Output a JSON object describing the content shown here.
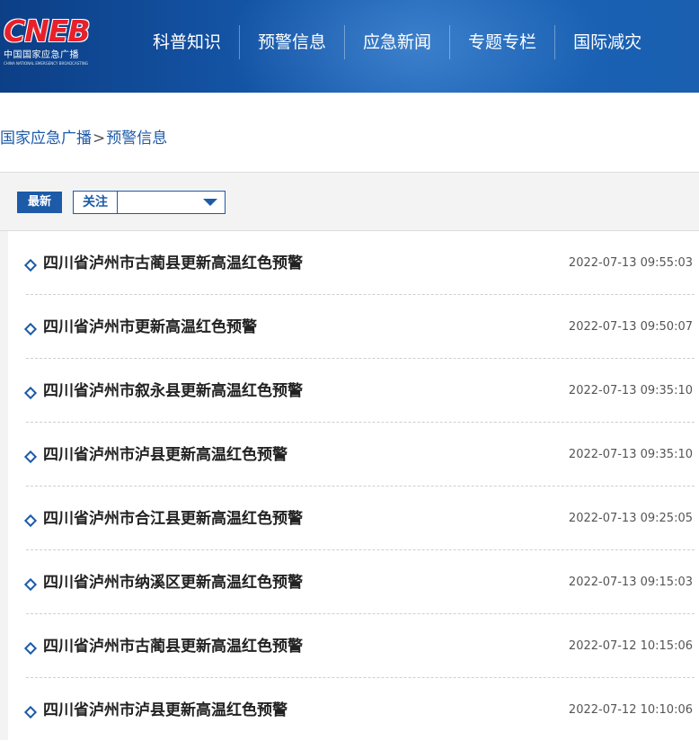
{
  "header": {
    "logo_mark": "CNEB",
    "logo_cn": "中国国家应急广播",
    "logo_en": "CHINA NATIONAL EMERGENCY BROADCASTING",
    "nav": [
      "科普知识",
      "预警信息",
      "应急新闻",
      "专题专栏",
      "国际减灾"
    ]
  },
  "breadcrumb": {
    "home": "国家应急广播",
    "separator": ">",
    "current": "预警信息"
  },
  "filters": {
    "latest_label": "最新",
    "follow_label": "关注",
    "follow_value": ""
  },
  "alerts": [
    {
      "title": "四川省泸州市古蔺县更新高温红色预警",
      "time": "2022-07-13 09:55:03"
    },
    {
      "title": "四川省泸州市更新高温红色预警",
      "time": "2022-07-13 09:50:07"
    },
    {
      "title": "四川省泸州市叙永县更新高温红色预警",
      "time": "2022-07-13 09:35:10"
    },
    {
      "title": "四川省泸州市泸县更新高温红色预警",
      "time": "2022-07-13 09:35:10"
    },
    {
      "title": "四川省泸州市合江县更新高温红色预警",
      "time": "2022-07-13 09:25:05"
    },
    {
      "title": "四川省泸州市纳溪区更新高温红色预警",
      "time": "2022-07-13 09:15:03"
    },
    {
      "title": "四川省泸州市古蔺县更新高温红色预警",
      "time": "2022-07-12 10:15:06"
    },
    {
      "title": "四川省泸州市泸县更新高温红色预警",
      "time": "2022-07-12 10:10:06"
    }
  ],
  "colors": {
    "header_bg": "#1556a8",
    "accent": "#1d5aa8",
    "logo_red": "#e8202a"
  }
}
